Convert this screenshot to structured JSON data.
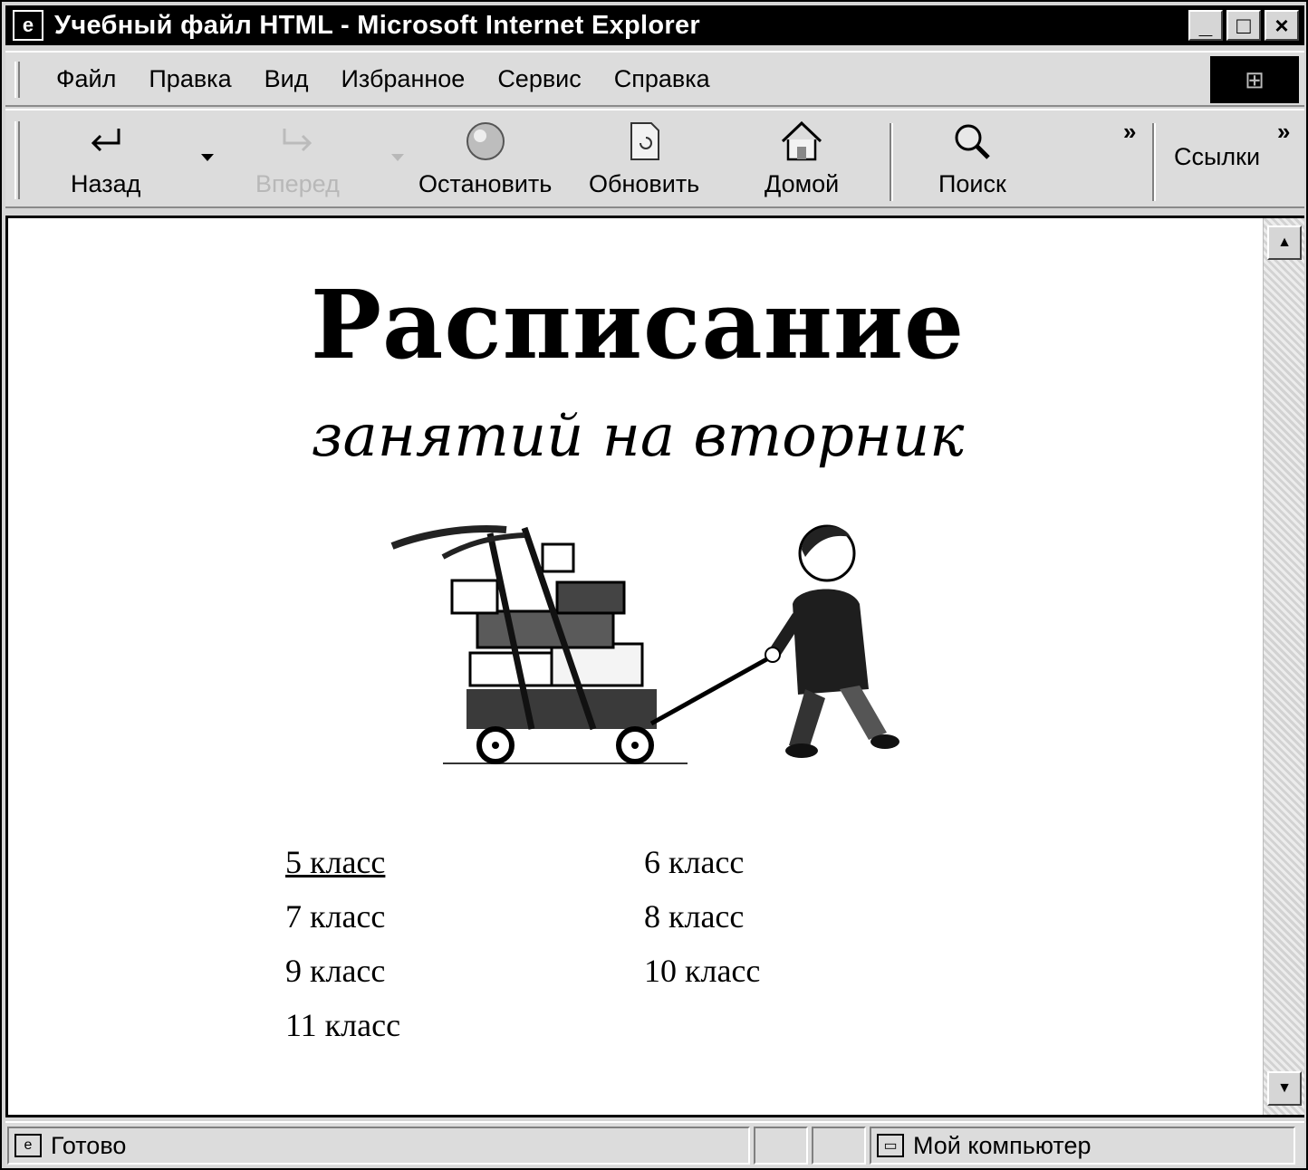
{
  "window": {
    "title": "Учебный файл HTML - Microsoft Internet Explorer",
    "controls": {
      "minimize": "_",
      "maximize": "□",
      "close": "×"
    }
  },
  "menu": {
    "items": [
      {
        "label": "Файл"
      },
      {
        "label": "Правка"
      },
      {
        "label": "Вид"
      },
      {
        "label": "Избранное"
      },
      {
        "label": "Сервис"
      },
      {
        "label": "Справка"
      }
    ]
  },
  "toolbar": {
    "back": "Назад",
    "forward": "Вперед",
    "stop": "Остановить",
    "refresh": "Обновить",
    "home": "Домой",
    "search": "Поиск",
    "more": "»",
    "links": "Ссылки",
    "links_more": "»"
  },
  "page": {
    "title": "Расписание",
    "subtitle": "занятий на вторник",
    "classes": [
      {
        "label": "5 класс",
        "active": true
      },
      {
        "label": "6 класс"
      },
      {
        "label": "7 класс"
      },
      {
        "label": "8 класс"
      },
      {
        "label": "9 класс"
      },
      {
        "label": "10 класс"
      },
      {
        "label": "11 класс"
      }
    ]
  },
  "status": {
    "text": "Готово",
    "zone": "Мой компьютер"
  },
  "icons": {
    "back": "back-arrow-icon",
    "forward": "forward-arrow-icon",
    "stop": "stop-icon",
    "refresh": "refresh-icon",
    "home": "home-icon",
    "search": "search-icon"
  }
}
